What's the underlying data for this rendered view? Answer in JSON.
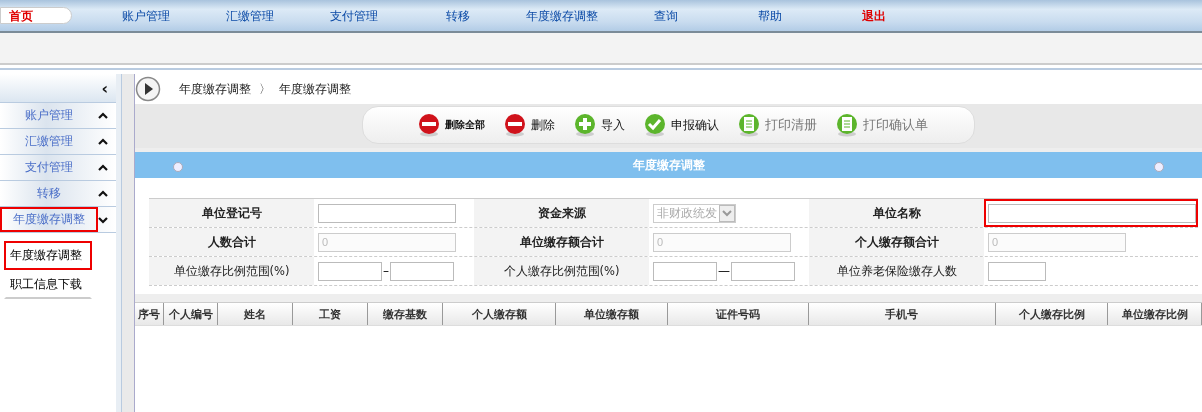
{
  "nav": [
    {
      "label": "首页",
      "selected": true,
      "kind": "normal"
    },
    {
      "label": "账户管理",
      "selected": false,
      "kind": "normal"
    },
    {
      "label": "汇缴管理",
      "selected": false,
      "kind": "normal"
    },
    {
      "label": "支付管理",
      "selected": false,
      "kind": "normal"
    },
    {
      "label": "转移",
      "selected": false,
      "kind": "normal"
    },
    {
      "label": "年度缴存调整",
      "selected": false,
      "kind": "normal"
    },
    {
      "label": "查询",
      "selected": false,
      "kind": "normal"
    },
    {
      "label": "帮助",
      "selected": false,
      "kind": "normal"
    },
    {
      "label": "退出",
      "selected": false,
      "kind": "exit"
    }
  ],
  "sidebar": {
    "collapse": "‹",
    "items": [
      {
        "label": "账户管理",
        "expanded": false,
        "highlighted": false
      },
      {
        "label": "汇缴管理",
        "expanded": false,
        "highlighted": false
      },
      {
        "label": "支付管理",
        "expanded": false,
        "highlighted": false
      },
      {
        "label": "转移",
        "expanded": false,
        "highlighted": false
      },
      {
        "label": "年度缴存调整",
        "expanded": true,
        "highlighted": true,
        "children": [
          {
            "label": "年度缴存调整",
            "highlighted": true
          },
          {
            "label": "职工信息下载",
            "highlighted": false
          }
        ]
      }
    ]
  },
  "breadcrumb": [
    "年度缴存调整",
    "年度缴存调整"
  ],
  "breadcrumb_separator": "〉",
  "toolbar": [
    {
      "label": "删除全部",
      "kind": "remove",
      "disabled": false,
      "small": true
    },
    {
      "label": "删除",
      "kind": "remove",
      "disabled": false,
      "small": false
    },
    {
      "label": "导入",
      "kind": "add",
      "disabled": false,
      "small": false
    },
    {
      "label": "申报确认",
      "kind": "confirm",
      "disabled": false,
      "small": false
    },
    {
      "label": "打印清册",
      "kind": "print",
      "disabled": true,
      "small": false
    },
    {
      "label": "打印确认单",
      "kind": "print",
      "disabled": true,
      "small": false
    }
  ],
  "panel_title": "年度缴存调整",
  "form": [
    [
      {
        "label": "单位登记号",
        "bold": true,
        "kind": "text",
        "highlighted": false,
        "disabled": false
      },
      {
        "label": "资金来源",
        "bold": true,
        "kind": "select",
        "value": "非财政统发",
        "highlighted": false,
        "disabled": true
      },
      {
        "label": "单位名称",
        "bold": true,
        "kind": "wide",
        "highlighted": true,
        "disabled": false
      }
    ],
    [
      {
        "label": "人数合计",
        "bold": true,
        "kind": "text",
        "value": "0",
        "highlighted": false,
        "disabled": true
      },
      {
        "label": "单位缴存额合计",
        "bold": true,
        "kind": "text",
        "value": "0",
        "highlighted": false,
        "disabled": true
      },
      {
        "label": "个人缴存额合计",
        "bold": true,
        "kind": "text",
        "value": "0",
        "highlighted": false,
        "disabled": true
      }
    ],
    [
      {
        "label": "单位缴存比例范围(%)",
        "bold": false,
        "kind": "range",
        "separator": "–",
        "highlighted": false,
        "disabled": false
      },
      {
        "label": "个人缴存比例范围(%)",
        "bold": false,
        "kind": "range",
        "separator": "—",
        "highlighted": false,
        "disabled": false
      },
      {
        "label": "单位养老保险缴存人数",
        "bold": false,
        "kind": "short",
        "highlighted": false,
        "disabled": false
      }
    ]
  ],
  "table": {
    "columns": [
      "序号",
      "个人编号",
      "姓名",
      "工资",
      "缴存基数",
      "个人缴存额",
      "单位缴存额",
      "证件号码",
      "手机号",
      "个人缴存比例",
      "单位缴存比例"
    ]
  }
}
